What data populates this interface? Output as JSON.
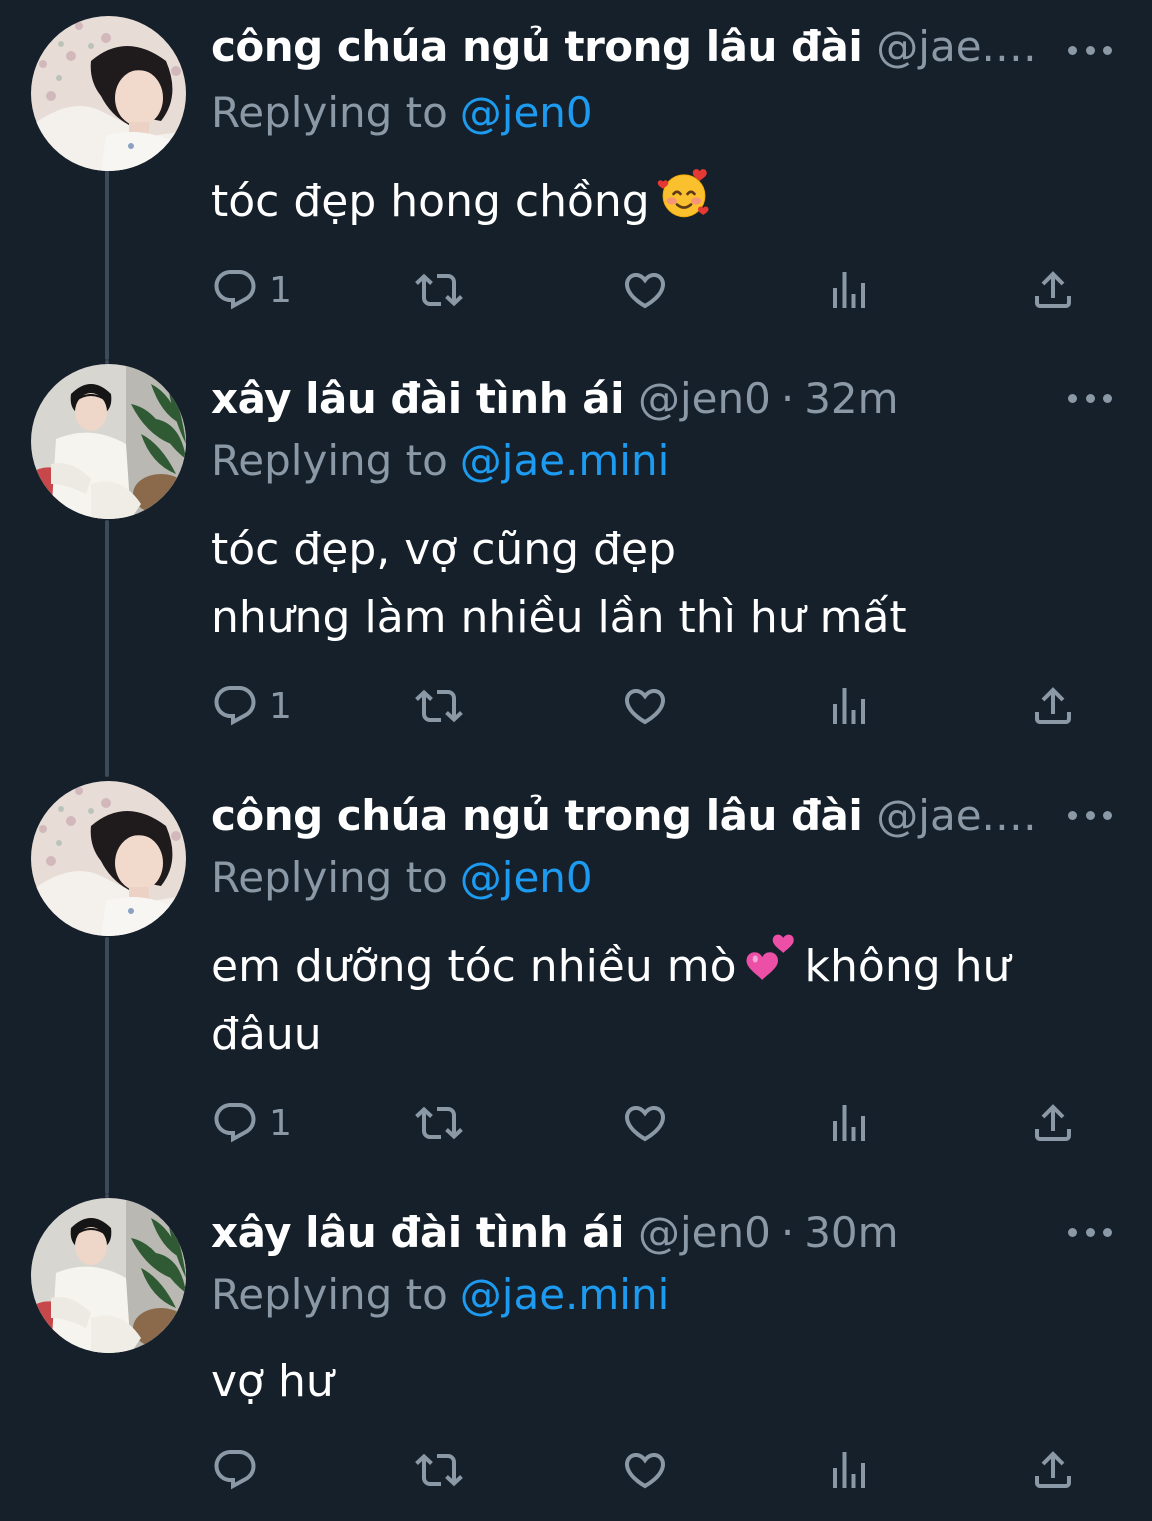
{
  "tweets": [
    {
      "author": "công chúa ngủ trong lâu đài",
      "handle": "@jae.min...",
      "time": "",
      "replying_label": "Replying to",
      "replying_to": "@jen0",
      "lines": [
        "tóc đẹp hong chồng"
      ],
      "emoji": "smiling-face-with-hearts",
      "reply_count": "1",
      "avatar": "avatar-jae-mini"
    },
    {
      "author": "xây lâu đài tình ái",
      "handle": "@jen0",
      "time": "32m",
      "replying_label": "Replying to",
      "replying_to": "@jae.mini",
      "lines": [
        "tóc đẹp, vợ cũng đẹp",
        "nhưng làm nhiều lần thì hư mất"
      ],
      "reply_count": "1",
      "avatar": "avatar-jen0"
    },
    {
      "author": "công chúa ngủ trong lâu đài",
      "handle": "@jae.min...",
      "time": "",
      "replying_label": "Replying to",
      "replying_to": "@jen0",
      "line1_before": "em dưỡng tóc nhiều mò",
      "line1_after": "không hư",
      "line2": "đâuu",
      "emoji": "two-hearts",
      "reply_count": "1",
      "avatar": "avatar-jae-mini"
    },
    {
      "author": "xây lâu đài tình ái",
      "handle": "@jen0",
      "time": "30m",
      "replying_label": "Replying to",
      "replying_to": "@jae.mini",
      "lines": [
        "vợ hư"
      ],
      "reply_count": "",
      "avatar": "avatar-jen0"
    }
  ],
  "icons": {
    "reply": "reply-icon",
    "retweet": "retweet-icon",
    "like": "heart-icon",
    "views": "views-icon",
    "share": "share-icon",
    "more": "more-icon"
  },
  "colors": {
    "background": "#15202b",
    "text": "#ffffff",
    "secondary": "#8b98a5",
    "link": "#1d9bf0",
    "thread_line": "#3d4a58"
  }
}
